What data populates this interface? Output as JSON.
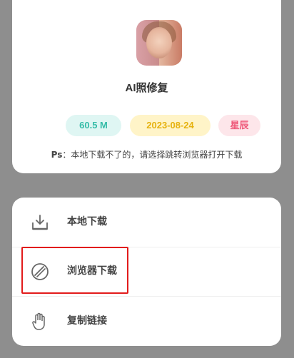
{
  "app": {
    "name": "AI照修复",
    "size": "60.5 M",
    "date": "2023-08-24",
    "tag": "星辰",
    "note_prefix": "Ps",
    "note_text": "：本地下载不了的，请选择跳转浏览器打开下载"
  },
  "actions": [
    {
      "label": "本地下载",
      "icon": "download-icon"
    },
    {
      "label": "浏览器下载",
      "icon": "browser-icon"
    },
    {
      "label": "复制链接",
      "icon": "hand-icon"
    }
  ],
  "colors": {
    "size_badge": "#36bca8",
    "date_badge": "#e6b20f",
    "tag_badge": "#ee5577",
    "highlight": "#e21b1b"
  }
}
